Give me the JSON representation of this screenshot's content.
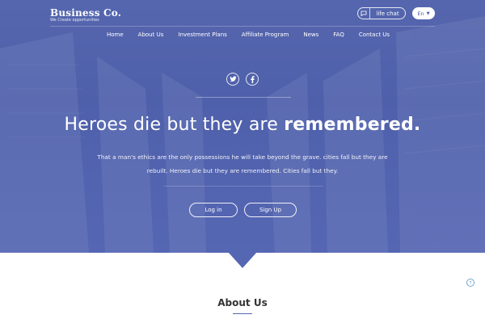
{
  "header": {
    "logo_name": "Business Co.",
    "logo_tagline": "We Create opportunities",
    "chat_label": "life chat",
    "chat_icon": "chat-bubble-icon",
    "language": "En"
  },
  "nav": {
    "items": [
      {
        "label": "Home"
      },
      {
        "label": "About Us"
      },
      {
        "label": "Investment Plans"
      },
      {
        "label": "Affiliate Program"
      },
      {
        "label": "News"
      },
      {
        "label": "FAQ"
      },
      {
        "label": "Contact Us"
      }
    ]
  },
  "social": {
    "twitter_icon": "twitter-icon",
    "facebook_icon": "facebook-icon"
  },
  "hero": {
    "headline_light": "Heroes die but they are ",
    "headline_bold": "remembered.",
    "text": "That a man's ethics are the only possessions he will take beyond the grave. cities fall but they are rebuilt. Heroes die but they are remembered. Cities fall but they.",
    "login_label": "Log in",
    "signup_label": "Sign Up"
  },
  "about": {
    "title": "About Us"
  },
  "colors": {
    "hero_blue": "#5566b3",
    "accent_light_blue": "#6fa6cf"
  }
}
